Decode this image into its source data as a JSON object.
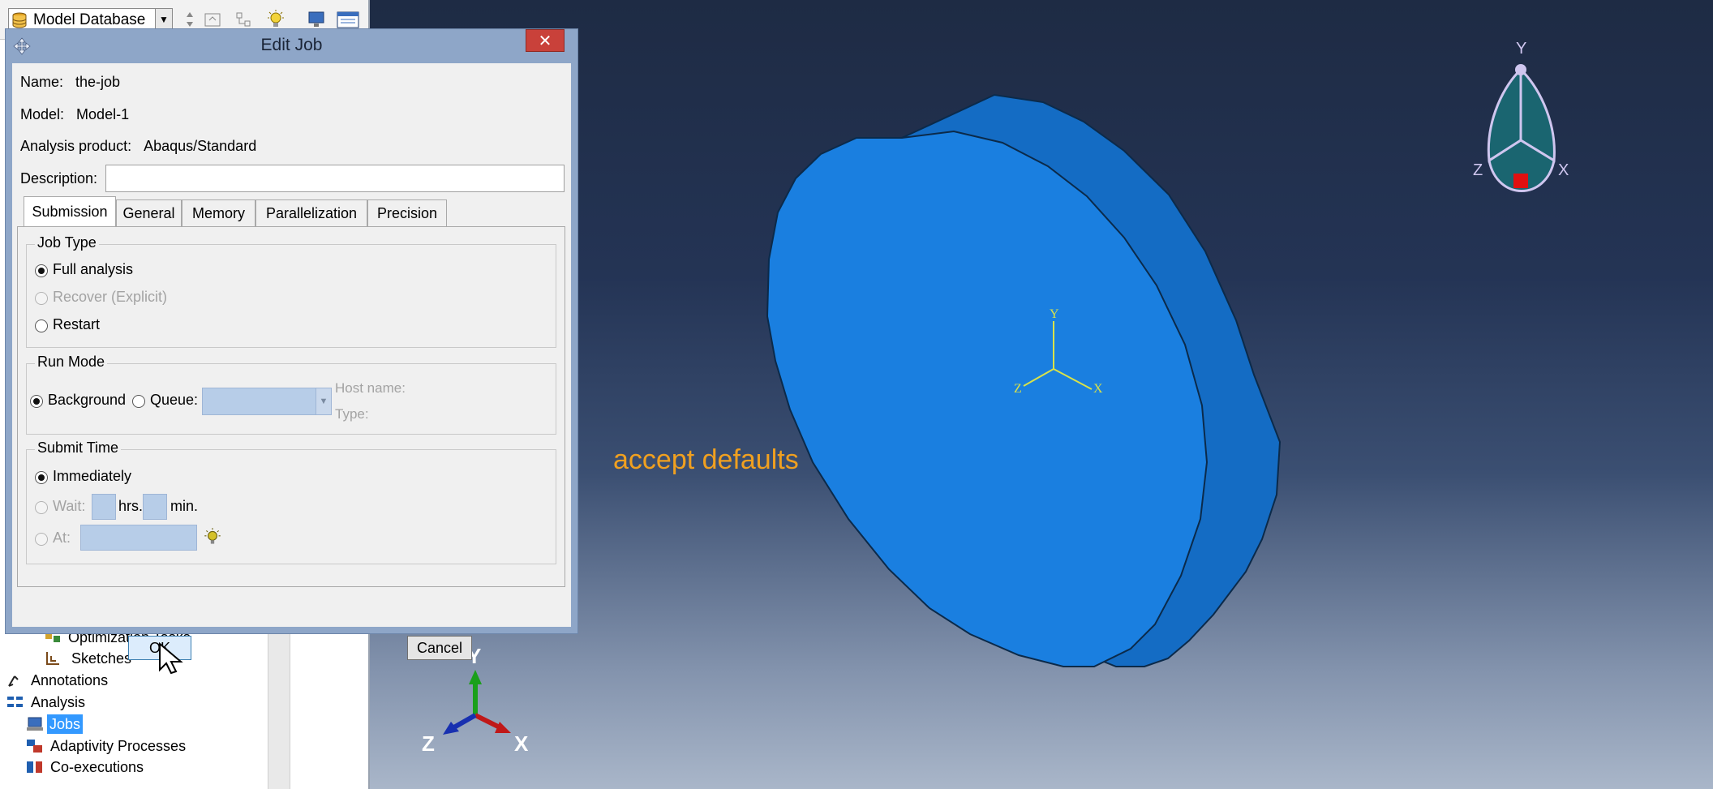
{
  "toolbar": {
    "db_selector": "Model Database",
    "icons": [
      "database-icon",
      "up-down-arrows-icon",
      "folder-up-icon",
      "tree-filter-icon",
      "lightbulb-icon",
      "monitor-icon",
      "window-icon"
    ]
  },
  "tree": {
    "items": [
      {
        "label": "Optimization Tasks",
        "icon": "optimization-tasks-icon"
      },
      {
        "label": "Sketches",
        "icon": "sketch-icon"
      },
      {
        "label": "Annotations",
        "icon": "annotation-icon"
      },
      {
        "label": "Analysis",
        "icon": "analysis-icon"
      },
      {
        "label": "Jobs",
        "icon": "jobs-icon",
        "selected": true
      },
      {
        "label": "Adaptivity Processes",
        "icon": "adaptivity-icon"
      },
      {
        "label": "Co-executions",
        "icon": "co-execution-icon"
      }
    ]
  },
  "dialog": {
    "title": "Edit Job",
    "close": "✕",
    "name_label": "Name:",
    "name_value": "the-job",
    "model_label": "Model:",
    "model_value": "Model-1",
    "product_label": "Analysis product:",
    "product_value": "Abaqus/Standard",
    "description_label": "Description:",
    "description_value": "",
    "tabs": [
      "Submission",
      "General",
      "Memory",
      "Parallelization",
      "Precision"
    ],
    "job_type": {
      "title": "Job Type",
      "options": [
        {
          "label": "Full analysis",
          "selected": true,
          "enabled": true
        },
        {
          "label": "Recover (Explicit)",
          "selected": false,
          "enabled": false
        },
        {
          "label": "Restart",
          "selected": false,
          "enabled": true
        }
      ]
    },
    "run_mode": {
      "title": "Run Mode",
      "background_label": "Background",
      "queue_label": "Queue:",
      "host_label": "Host name:",
      "type_label": "Type:",
      "selected": "Background"
    },
    "submit_time": {
      "title": "Submit Time",
      "immediately_label": "Immediately",
      "wait_label": "Wait:",
      "hrs_label": "hrs.",
      "min_label": "min.",
      "at_label": "At:",
      "selected": "Immediately"
    },
    "ok_label": "OK",
    "cancel_label": "Cancel"
  },
  "viewport": {
    "annotation": "accept defaults",
    "triad_top": {
      "x": "X",
      "y": "Y",
      "z": "Z"
    },
    "triad_center": {
      "x": "X",
      "y": "Y",
      "z": "Z"
    },
    "triad_bottom": {
      "x": "X",
      "y": "Y",
      "z": "Z"
    },
    "part_color": "#1a7fe0"
  },
  "colors": {
    "dialog_frame": "#8ea6c8",
    "close_button": "#c9413a",
    "annotation_text": "#f0a020",
    "selection": "#3399ff"
  }
}
